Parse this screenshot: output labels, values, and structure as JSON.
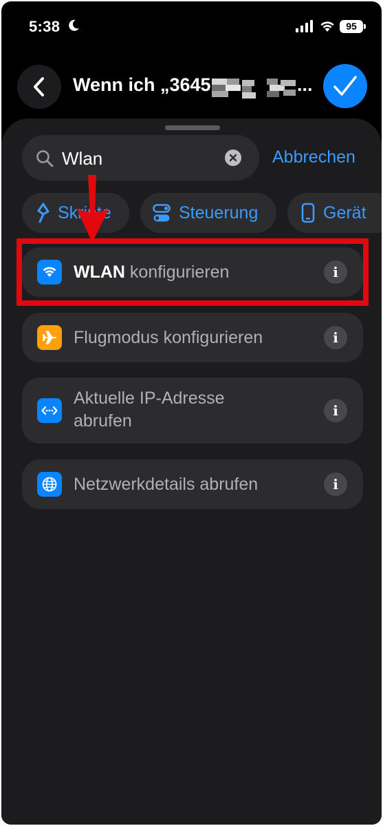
{
  "status_bar": {
    "time": "5:38",
    "battery": "95",
    "icons": [
      "moon-icon",
      "cellular-signal-icon",
      "wifi-icon",
      "battery-icon"
    ]
  },
  "header": {
    "title": "Wenn ich „3645",
    "title_suffix": "...",
    "back_icon": "chevron-left-icon",
    "done_icon": "checkmark-icon"
  },
  "search": {
    "value": "Wlan",
    "cancel_label": "Abbrechen",
    "icons": [
      "magnifier-icon",
      "clear-icon"
    ]
  },
  "categories": [
    {
      "label": "Skripte",
      "icon": "scripting-icon"
    },
    {
      "label": "Steuerung",
      "icon": "toggle-icon"
    },
    {
      "label": "Gerät",
      "icon": "phone-icon"
    }
  ],
  "results": [
    {
      "bold": "WLAN",
      "rest": " konfigurieren",
      "icon": "wifi-icon",
      "icon_color": "#0a84ff"
    },
    {
      "bold": "",
      "rest": "Flugmodus konfigurieren",
      "icon": "airplane-icon",
      "icon_color": "#ff9f0a"
    },
    {
      "bold": "",
      "rest": "Aktuelle IP-Adresse",
      "rest2": "abrufen",
      "icon": "ip-address-icon",
      "icon_color": "#0a84ff"
    },
    {
      "bold": "",
      "rest": "Netzwerkdetails abrufen",
      "icon": "globe-icon",
      "icon_color": "#0a84ff"
    }
  ],
  "info_label": "i",
  "colors": {
    "accent": "#0a84ff",
    "link": "#3a9bff",
    "highlight": "#e3080e",
    "background": "#000000",
    "sheet": "#1c1c1e",
    "cell": "#2c2c2e"
  }
}
